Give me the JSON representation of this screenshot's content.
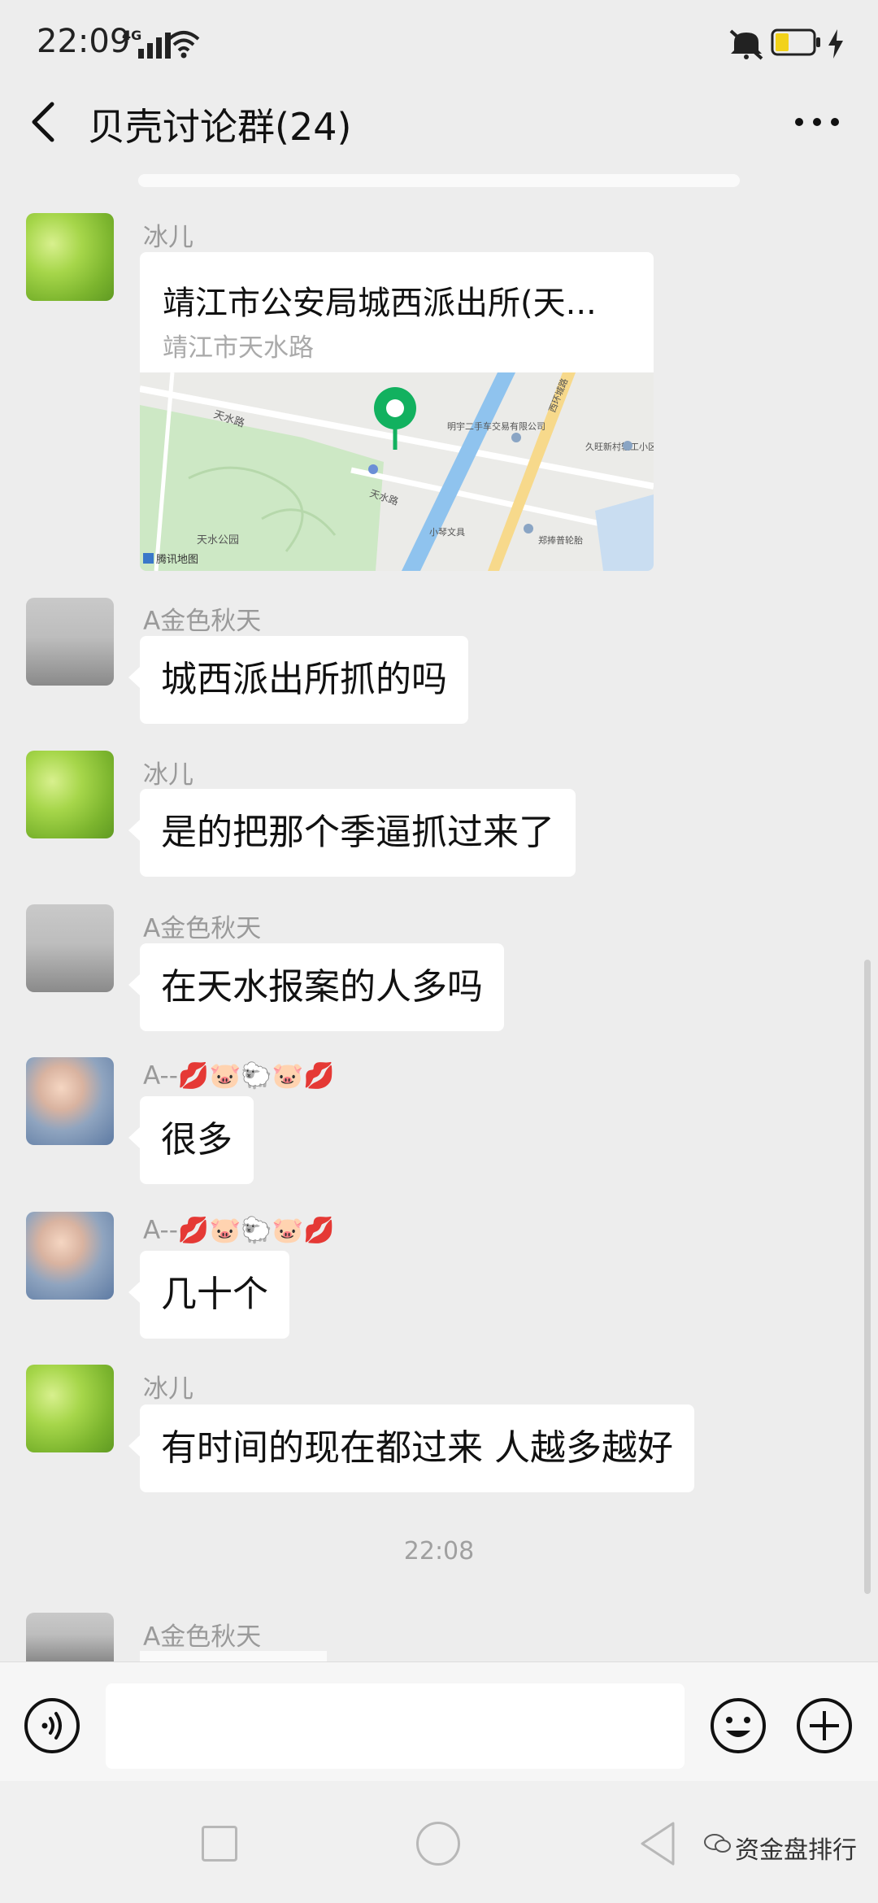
{
  "status_bar": {
    "time": "22:09",
    "network": "4G",
    "icons": [
      "signal-icon",
      "wifi-icon",
      "mute-icon",
      "battery-icon",
      "charging-icon"
    ]
  },
  "header": {
    "title": "贝壳讨论群(24)",
    "back_icon": "chevron-left-icon",
    "more_icon": "more-dots-icon"
  },
  "messages": [
    {
      "sender": "冰儿",
      "avatar": "grass-avatar",
      "type": "location",
      "location_title": "靖江市公安局城西派出所(天...",
      "location_address": "靖江市天水路",
      "map": {
        "labels": [
          "天水路",
          "天水路",
          "天水公园",
          "明宇二手车交易有限公司",
          "西环城路",
          "久旺新村轻工小区",
          "小琴文具",
          "郑捧普轮胎"
        ],
        "provider": "腾讯地图"
      }
    },
    {
      "sender": "A金色秋天",
      "avatar": "motorcycle-avatar",
      "type": "text",
      "text": "城西派出所抓的吗"
    },
    {
      "sender": "冰儿",
      "avatar": "grass-avatar",
      "type": "text",
      "text": "是的把那个季逼抓过来了"
    },
    {
      "sender": "A金色秋天",
      "avatar": "motorcycle-avatar",
      "type": "text",
      "text": "在天水报案的人多吗"
    },
    {
      "sender": "A--💋🐷🐑🐷💋",
      "avatar": "baby-avatar",
      "type": "text",
      "text": "很多"
    },
    {
      "sender": "A--💋🐷🐑🐷💋",
      "avatar": "baby-avatar",
      "type": "text",
      "text": "几十个"
    },
    {
      "sender": "冰儿",
      "avatar": "grass-avatar",
      "type": "text",
      "text": "有时间的现在都过来 人越多越好"
    }
  ],
  "time_divider": "22:08",
  "partial_message": {
    "sender": "A金色秋天",
    "avatar": "motorcycle-avatar"
  },
  "input_bar": {
    "voice_icon": "voice-icon",
    "emoji_icon": "emoji-icon",
    "plus_icon": "plus-icon",
    "value": ""
  },
  "nav_bar": {
    "icons": [
      "recent-apps-icon",
      "home-icon",
      "back-triangle-icon"
    ],
    "watermark": "资金盘排行"
  }
}
